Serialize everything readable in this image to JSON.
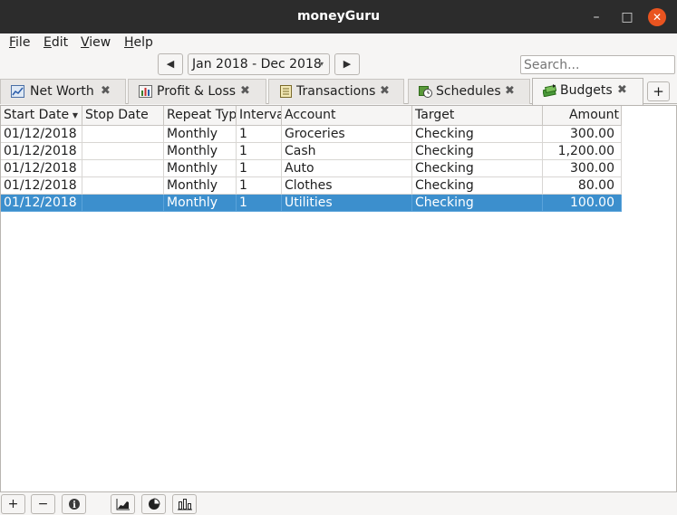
{
  "window": {
    "title": "moneyGuru",
    "minimize_glyph": "–",
    "maximize_glyph": "□",
    "close_glyph": "✕"
  },
  "menu": [
    {
      "label": "File",
      "mnemonic": "F",
      "rest": "ile"
    },
    {
      "label": "Edit",
      "mnemonic": "E",
      "rest": "dit"
    },
    {
      "label": "View",
      "mnemonic": "V",
      "rest": "iew"
    },
    {
      "label": "Help",
      "mnemonic": "H",
      "rest": "elp"
    }
  ],
  "toolbar": {
    "prev_glyph": "◀",
    "next_glyph": "▶",
    "date_range": "Jan 2018 - Dec 2018",
    "date_caret": "▾",
    "search_placeholder": "Search..."
  },
  "tabs": [
    {
      "label": "Net Worth",
      "icon": "net-worth-chart-icon",
      "close": "✖",
      "active": false
    },
    {
      "label": "Profit & Loss",
      "icon": "profit-loss-bars-icon",
      "close": "✖",
      "active": false
    },
    {
      "label": "Transactions",
      "icon": "transactions-ledger-icon",
      "close": "✖",
      "active": false
    },
    {
      "label": "Schedules",
      "icon": "schedules-clock-icon",
      "close": "✖",
      "active": false
    },
    {
      "label": "Budgets",
      "icon": "budgets-money-icon",
      "close": "✖",
      "active": true
    }
  ],
  "add_tab_label": "+",
  "table": {
    "columns": [
      "Start Date",
      "Stop Date",
      "Repeat Typ",
      "Interva",
      "Account",
      "Target",
      "Amount"
    ],
    "sort_glyph": "▼",
    "rows": [
      [
        "01/12/2018",
        "",
        "Monthly",
        "1",
        "Groceries",
        "Checking",
        "300.00"
      ],
      [
        "01/12/2018",
        "",
        "Monthly",
        "1",
        "Cash",
        "Checking",
        "1,200.00"
      ],
      [
        "01/12/2018",
        "",
        "Monthly",
        "1",
        "Auto",
        "Checking",
        "300.00"
      ],
      [
        "01/12/2018",
        "",
        "Monthly",
        "1",
        "Clothes",
        "Checking",
        "80.00"
      ],
      [
        "01/12/2018",
        "",
        "Monthly",
        "1",
        "Utilities",
        "Checking",
        "100.00"
      ]
    ],
    "selected_row": 4
  },
  "bottom_buttons": {
    "add": "+",
    "remove": "−",
    "info": "i"
  },
  "colors": {
    "selection": "#3c8fcd",
    "titlebar": "#2c2c2c",
    "close_button": "#e95420"
  }
}
